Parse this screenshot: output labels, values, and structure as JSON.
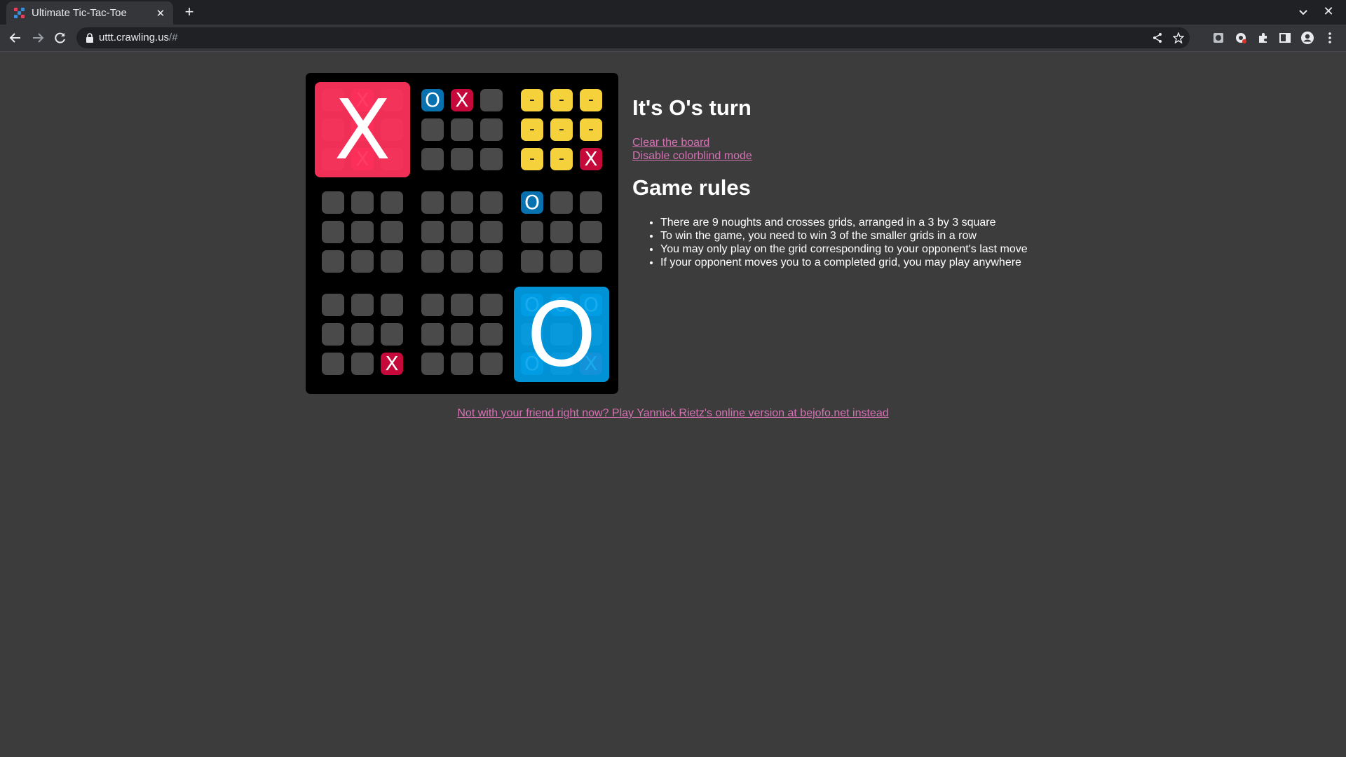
{
  "browser": {
    "tab_title": "Ultimate Tic-Tac-Toe",
    "url_host": "uttt.crawling.us",
    "url_path": "/#",
    "icons": [
      "back-icon",
      "forward-icon",
      "reload-icon",
      "lock-icon",
      "share-icon",
      "star-icon",
      "extension-icon",
      "puzzle-icon",
      "side-panel-icon",
      "profile-icon",
      "menu-icon"
    ]
  },
  "game": {
    "turn_text": "It's O's turn",
    "links": {
      "clear": "Clear the board",
      "colorblind": "Disable colorblind mode"
    },
    "rules_title": "Game rules",
    "rules": [
      "There are 9 noughts and crosses grids, arranged in a 3 by 3 square",
      "To win the game, you need to win 3 of the smaller grids in a row",
      "You may only play on the grid corresponding to your opponent's last move",
      "If your opponent moves you to a completed grid, you may play anywhere"
    ],
    "footer_link": "Not with your friend right now? Play Yannick Rietz's online version at bejofo.net instead",
    "colors": {
      "x": "#c6093b",
      "o": "#0871b0",
      "draw": "#f5d13b",
      "x_win": "#ff325c",
      "o_win": "#00a2eb",
      "link": "#d472b3"
    },
    "grids": [
      {
        "winner": "X",
        "cells": [
          "",
          "X",
          "",
          "",
          "X",
          "",
          "",
          "X",
          ""
        ]
      },
      {
        "winner": "",
        "cells": [
          "O",
          "X",
          "",
          "",
          "",
          "",
          "",
          "",
          ""
        ]
      },
      {
        "winner": "draw",
        "cells": [
          "-",
          "-",
          "-",
          "-",
          "-",
          "-",
          "-",
          "-",
          "X"
        ]
      },
      {
        "winner": "",
        "cells": [
          "",
          "",
          "",
          "",
          "",
          "",
          "",
          "",
          ""
        ]
      },
      {
        "winner": "",
        "cells": [
          "",
          "",
          "",
          "",
          "",
          "",
          "",
          "",
          ""
        ]
      },
      {
        "winner": "",
        "cells": [
          "O",
          "",
          "",
          "",
          "",
          "",
          "",
          "",
          ""
        ]
      },
      {
        "winner": "",
        "cells": [
          "",
          "",
          "",
          "",
          "",
          "",
          "",
          "",
          "X"
        ]
      },
      {
        "winner": "",
        "cells": [
          "",
          "",
          "",
          "",
          "",
          "",
          "",
          "",
          ""
        ]
      },
      {
        "winner": "O",
        "cells": [
          "O",
          "O",
          "O",
          "",
          "",
          "",
          "O",
          "",
          "X"
        ]
      }
    ]
  }
}
